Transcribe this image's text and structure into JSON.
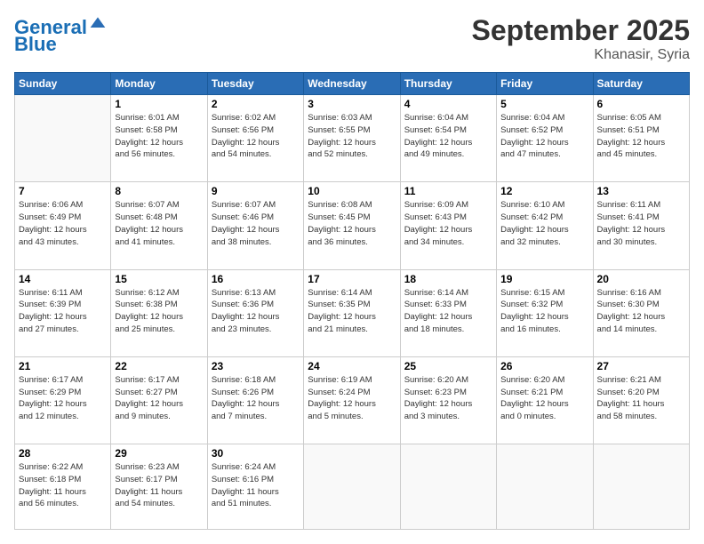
{
  "logo": {
    "line1": "General",
    "line2": "Blue"
  },
  "title": "September 2025",
  "location": "Khanasir, Syria",
  "days_header": [
    "Sunday",
    "Monday",
    "Tuesday",
    "Wednesday",
    "Thursday",
    "Friday",
    "Saturday"
  ],
  "weeks": [
    [
      {
        "day": "",
        "info": ""
      },
      {
        "day": "1",
        "info": "Sunrise: 6:01 AM\nSunset: 6:58 PM\nDaylight: 12 hours\nand 56 minutes."
      },
      {
        "day": "2",
        "info": "Sunrise: 6:02 AM\nSunset: 6:56 PM\nDaylight: 12 hours\nand 54 minutes."
      },
      {
        "day": "3",
        "info": "Sunrise: 6:03 AM\nSunset: 6:55 PM\nDaylight: 12 hours\nand 52 minutes."
      },
      {
        "day": "4",
        "info": "Sunrise: 6:04 AM\nSunset: 6:54 PM\nDaylight: 12 hours\nand 49 minutes."
      },
      {
        "day": "5",
        "info": "Sunrise: 6:04 AM\nSunset: 6:52 PM\nDaylight: 12 hours\nand 47 minutes."
      },
      {
        "day": "6",
        "info": "Sunrise: 6:05 AM\nSunset: 6:51 PM\nDaylight: 12 hours\nand 45 minutes."
      }
    ],
    [
      {
        "day": "7",
        "info": "Sunrise: 6:06 AM\nSunset: 6:49 PM\nDaylight: 12 hours\nand 43 minutes."
      },
      {
        "day": "8",
        "info": "Sunrise: 6:07 AM\nSunset: 6:48 PM\nDaylight: 12 hours\nand 41 minutes."
      },
      {
        "day": "9",
        "info": "Sunrise: 6:07 AM\nSunset: 6:46 PM\nDaylight: 12 hours\nand 38 minutes."
      },
      {
        "day": "10",
        "info": "Sunrise: 6:08 AM\nSunset: 6:45 PM\nDaylight: 12 hours\nand 36 minutes."
      },
      {
        "day": "11",
        "info": "Sunrise: 6:09 AM\nSunset: 6:43 PM\nDaylight: 12 hours\nand 34 minutes."
      },
      {
        "day": "12",
        "info": "Sunrise: 6:10 AM\nSunset: 6:42 PM\nDaylight: 12 hours\nand 32 minutes."
      },
      {
        "day": "13",
        "info": "Sunrise: 6:11 AM\nSunset: 6:41 PM\nDaylight: 12 hours\nand 30 minutes."
      }
    ],
    [
      {
        "day": "14",
        "info": "Sunrise: 6:11 AM\nSunset: 6:39 PM\nDaylight: 12 hours\nand 27 minutes."
      },
      {
        "day": "15",
        "info": "Sunrise: 6:12 AM\nSunset: 6:38 PM\nDaylight: 12 hours\nand 25 minutes."
      },
      {
        "day": "16",
        "info": "Sunrise: 6:13 AM\nSunset: 6:36 PM\nDaylight: 12 hours\nand 23 minutes."
      },
      {
        "day": "17",
        "info": "Sunrise: 6:14 AM\nSunset: 6:35 PM\nDaylight: 12 hours\nand 21 minutes."
      },
      {
        "day": "18",
        "info": "Sunrise: 6:14 AM\nSunset: 6:33 PM\nDaylight: 12 hours\nand 18 minutes."
      },
      {
        "day": "19",
        "info": "Sunrise: 6:15 AM\nSunset: 6:32 PM\nDaylight: 12 hours\nand 16 minutes."
      },
      {
        "day": "20",
        "info": "Sunrise: 6:16 AM\nSunset: 6:30 PM\nDaylight: 12 hours\nand 14 minutes."
      }
    ],
    [
      {
        "day": "21",
        "info": "Sunrise: 6:17 AM\nSunset: 6:29 PM\nDaylight: 12 hours\nand 12 minutes."
      },
      {
        "day": "22",
        "info": "Sunrise: 6:17 AM\nSunset: 6:27 PM\nDaylight: 12 hours\nand 9 minutes."
      },
      {
        "day": "23",
        "info": "Sunrise: 6:18 AM\nSunset: 6:26 PM\nDaylight: 12 hours\nand 7 minutes."
      },
      {
        "day": "24",
        "info": "Sunrise: 6:19 AM\nSunset: 6:24 PM\nDaylight: 12 hours\nand 5 minutes."
      },
      {
        "day": "25",
        "info": "Sunrise: 6:20 AM\nSunset: 6:23 PM\nDaylight: 12 hours\nand 3 minutes."
      },
      {
        "day": "26",
        "info": "Sunrise: 6:20 AM\nSunset: 6:21 PM\nDaylight: 12 hours\nand 0 minutes."
      },
      {
        "day": "27",
        "info": "Sunrise: 6:21 AM\nSunset: 6:20 PM\nDaylight: 11 hours\nand 58 minutes."
      }
    ],
    [
      {
        "day": "28",
        "info": "Sunrise: 6:22 AM\nSunset: 6:18 PM\nDaylight: 11 hours\nand 56 minutes."
      },
      {
        "day": "29",
        "info": "Sunrise: 6:23 AM\nSunset: 6:17 PM\nDaylight: 11 hours\nand 54 minutes."
      },
      {
        "day": "30",
        "info": "Sunrise: 6:24 AM\nSunset: 6:16 PM\nDaylight: 11 hours\nand 51 minutes."
      },
      {
        "day": "",
        "info": ""
      },
      {
        "day": "",
        "info": ""
      },
      {
        "day": "",
        "info": ""
      },
      {
        "day": "",
        "info": ""
      }
    ]
  ]
}
